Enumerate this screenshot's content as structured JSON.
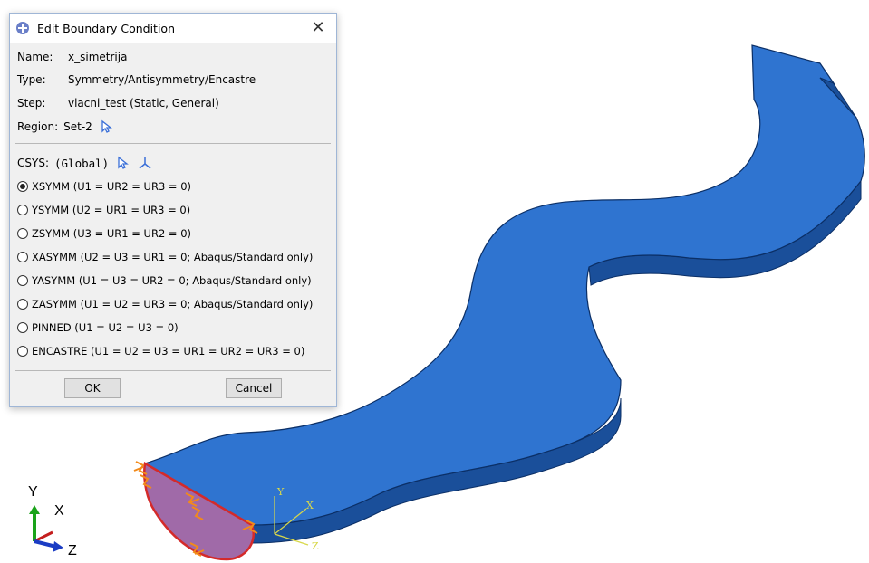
{
  "dialog": {
    "title": "Edit Boundary Condition",
    "close_glyph": "✕",
    "name_label": "Name:",
    "name_value": "x_simetrija",
    "type_label": "Type:",
    "type_value": "Symmetry/Antisymmetry/Encastre",
    "step_label": "Step:",
    "step_value": "vlacni_test (Static, General)",
    "region_label": "Region:",
    "region_value": "Set-2",
    "csys_label": "CSYS:",
    "csys_value": "(Global)",
    "options": [
      {
        "label": "XSYMM (U1 = UR2 = UR3 = 0)",
        "selected": true
      },
      {
        "label": "YSYMM (U2 = UR1 = UR3 = 0)",
        "selected": false
      },
      {
        "label": "ZSYMM (U3 = UR1 = UR2 = 0)",
        "selected": false
      },
      {
        "label": "XASYMM (U2 = U3 = UR1 = 0; Abaqus/Standard only)",
        "selected": false
      },
      {
        "label": "YASYMM (U1 = U3 = UR2 = 0; Abaqus/Standard only)",
        "selected": false
      },
      {
        "label": "ZASYMM (U1 = U2 = UR3 = 0; Abaqus/Standard only)",
        "selected": false
      },
      {
        "label": "PINNED (U1 = U2 = U3 = 0)",
        "selected": false
      },
      {
        "label": "ENCASTRE (U1 = U2 = U3 = UR1 = UR2 = UR3 = 0)",
        "selected": false
      }
    ],
    "ok_label": "OK",
    "cancel_label": "Cancel"
  },
  "viewport": {
    "part_color": "#2f74d0",
    "part_side_color": "#1a4f9a",
    "region_fill_color": "#a06aa8",
    "region_edge_color": "#d42a2a",
    "marker_color": "#f28a1a",
    "local_csys_labels": {
      "y": "Y",
      "x": "X",
      "z": "Z"
    },
    "triad_labels": {
      "y": "Y",
      "x": "X",
      "z": "Z"
    }
  }
}
